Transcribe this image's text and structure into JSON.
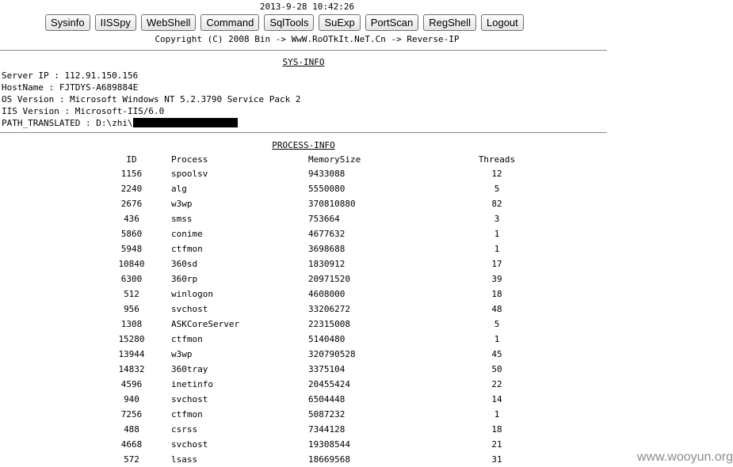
{
  "header": {
    "timestamp": "2013-9-28 10:42:26",
    "copyright": "Copyright (C) 2008 Bin -> WwW.RoOTkIt.NeT.Cn -> Reverse-IP"
  },
  "nav": {
    "buttons": [
      "Sysinfo",
      "IISSpy",
      "WebShell",
      "Command",
      "SqlTools",
      "SuExp",
      "PortScan",
      "RegShell",
      "Logout"
    ]
  },
  "sysinfo": {
    "title": "SYS-INFO",
    "server_ip": "Server IP : 112.91.150.156",
    "hostname": "HostName : FJTDYS-A689884E",
    "os_version": "OS Version : Microsoft Windows NT 5.2.3790 Service Pack 2",
    "iis_version": "IIS Version : Microsoft-IIS/6.0",
    "path_translated": "PATH_TRANSLATED : D:\\zhi\\"
  },
  "processinfo": {
    "title": "PROCESS-INFO",
    "columns": [
      "ID",
      "Process",
      "MemorySize",
      "Threads"
    ],
    "rows": [
      [
        "1156",
        "spoolsv",
        "9433088",
        "12"
      ],
      [
        "2240",
        "alg",
        "5550080",
        "5"
      ],
      [
        "2676",
        "w3wp",
        "370810880",
        "82"
      ],
      [
        "436",
        "smss",
        "753664",
        "3"
      ],
      [
        "5860",
        "conime",
        "4677632",
        "1"
      ],
      [
        "5948",
        "ctfmon",
        "3698688",
        "1"
      ],
      [
        "10840",
        "360sd",
        "1830912",
        "17"
      ],
      [
        "6300",
        "360rp",
        "20971520",
        "39"
      ],
      [
        "512",
        "winlogon",
        "4608000",
        "18"
      ],
      [
        "956",
        "svchost",
        "33206272",
        "48"
      ],
      [
        "1308",
        "ASKCoreServer",
        "22315008",
        "5"
      ],
      [
        "15280",
        "ctfmon",
        "5140480",
        "1"
      ],
      [
        "13944",
        "w3wp",
        "320790528",
        "45"
      ],
      [
        "14832",
        "360tray",
        "3375104",
        "50"
      ],
      [
        "4596",
        "inetinfo",
        "20455424",
        "22"
      ],
      [
        "940",
        "svchost",
        "6504448",
        "14"
      ],
      [
        "7256",
        "ctfmon",
        "5087232",
        "1"
      ],
      [
        "488",
        "csrss",
        "7344128",
        "18"
      ],
      [
        "4668",
        "svchost",
        "19308544",
        "21"
      ],
      [
        "572",
        "lsass",
        "18669568",
        "31"
      ]
    ]
  },
  "watermark": "www.wooyun.org"
}
